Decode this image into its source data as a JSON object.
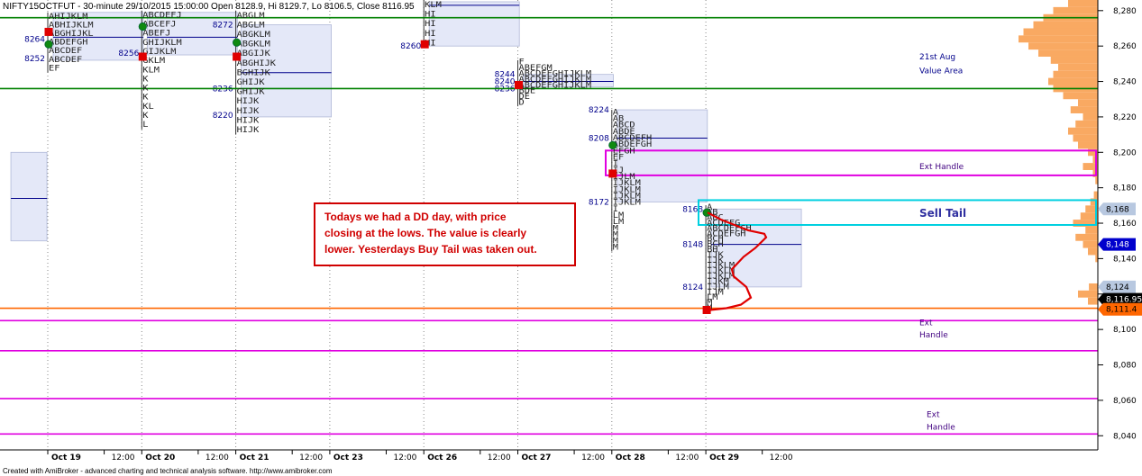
{
  "header": {
    "title": "NIFTY15OCTFUT - 30-minute 29/10/2015 15:00:00 Open 8128.9, Hi 8129.7, Lo 8106.5, Close 8116.95"
  },
  "footer": {
    "text": "Created with AmiBroker - advanced charting and technical analysis software. http://www.amibroker.com"
  },
  "annotation": {
    "lines": [
      "Todays we had a DD day, with price",
      "closing at the lows. The value is clearly",
      "lower. Yesterdays Buy Tail was taken out."
    ]
  },
  "chart_data": {
    "type": "market-profile",
    "ylim": [
      8032,
      8286
    ],
    "yticks": [
      8040,
      8060,
      8080,
      8100,
      8120,
      8140,
      8160,
      8180,
      8200,
      8220,
      8240,
      8260,
      8280
    ],
    "ytick_labels": [
      "8,040",
      "8,060",
      "8,080",
      "8,100",
      "8,120",
      "8,140",
      "8,160",
      "8,180",
      "8,200",
      "8,220",
      "8,240",
      "8,260",
      "8,280"
    ],
    "x_labels": [
      {
        "text": "Oct 19",
        "bold": true,
        "day": 0
      },
      {
        "text": "12:00",
        "bold": false,
        "day": 0.6
      },
      {
        "text": "Oct 20",
        "bold": true,
        "day": 1
      },
      {
        "text": "12:00",
        "bold": false,
        "day": 1.6
      },
      {
        "text": "Oct 21",
        "bold": true,
        "day": 2
      },
      {
        "text": "12:00",
        "bold": false,
        "day": 2.6
      },
      {
        "text": "Oct 23",
        "bold": true,
        "day": 3
      },
      {
        "text": "12:00",
        "bold": false,
        "day": 3.6
      },
      {
        "text": "Oct 26",
        "bold": true,
        "day": 4
      },
      {
        "text": "12:00",
        "bold": false,
        "day": 4.6
      },
      {
        "text": "Oct 27",
        "bold": true,
        "day": 5
      },
      {
        "text": "12:00",
        "bold": false,
        "day": 5.6
      },
      {
        "text": "Oct 28",
        "bold": true,
        "day": 6
      },
      {
        "text": "12:00",
        "bold": false,
        "day": 6.6
      },
      {
        "text": "Oct 29",
        "bold": true,
        "day": 7
      },
      {
        "text": "12:00",
        "bold": false,
        "day": 7.6
      }
    ],
    "levels": [
      {
        "price": 8276,
        "color": "#008000"
      },
      {
        "price": 8236,
        "color": "#008000"
      },
      {
        "price": 8112,
        "color": "#ff6600"
      },
      {
        "price": 8105,
        "color": "#e000e0"
      },
      {
        "price": 8088,
        "color": "#e000e0"
      },
      {
        "price": 8061,
        "color": "#e000e0"
      },
      {
        "price": 8041,
        "color": "#e000e0"
      }
    ],
    "profiles": [
      {
        "day": -0.45,
        "value_high": 8200,
        "value_low": 8150,
        "poc": 8174,
        "rows": [],
        "labels": []
      },
      {
        "day": 0,
        "value_high": 8279,
        "value_low": 8252,
        "poc": 8265,
        "high": 8279,
        "low": 8245,
        "rows": [
          "AHIJKLM",
          "ABHIJKLM",
          "ABGHIJKL",
          "ABDEFGH",
          "ABCDEF",
          "ABCDEF",
          "EF"
        ],
        "labels": [
          {
            "text": "8264",
            "price": 8264
          },
          {
            "text": "8252",
            "price": 8253
          }
        ],
        "markers": [
          {
            "type": "open",
            "price": 8261
          },
          {
            "type": "close",
            "price": 8268
          }
        ]
      },
      {
        "day": 1,
        "value_high": 8279,
        "value_low": 8255,
        "poc": 8265,
        "high": 8280,
        "low": 8213,
        "rows": [
          "ABCDEFJ",
          "ABCEFJ",
          "ABEFJ",
          "GHIJKLM",
          "GIJKLM",
          "GKLM",
          "KLM",
          "K",
          "K",
          "K",
          "KL",
          "K",
          "L"
        ],
        "labels": [
          {
            "text": "8256",
            "price": 8256
          }
        ],
        "markers": [
          {
            "type": "open",
            "price": 8271
          },
          {
            "type": "close",
            "price": 8254
          }
        ]
      },
      {
        "day": 2,
        "value_high": 8272,
        "value_low": 8220,
        "poc": 8245,
        "high": 8280,
        "low": 8210,
        "rows": [
          "ABGLM",
          "ABGLM",
          "ABGKLM",
          "ABGKLM",
          "ABGIJK",
          "ABGHIJK",
          "BGHIJK",
          "GHIJK",
          "GHIJK",
          "HIJK",
          "HIJK",
          "HIJK",
          "HIJK"
        ],
        "labels": [
          {
            "text": "8272",
            "price": 8272
          },
          {
            "text": "8236",
            "price": 8236
          },
          {
            "text": "8220",
            "price": 8221
          }
        ],
        "markers": [
          {
            "type": "open",
            "price": 8262
          },
          {
            "type": "close",
            "price": 8254
          }
        ]
      },
      {
        "day": 4,
        "value_high": 8285,
        "value_low": 8260,
        "poc": 8283,
        "high": 8286,
        "low": 8259,
        "rows": [
          "KLM",
          "HI",
          "HI",
          "HI",
          "HI"
        ],
        "labels": [
          {
            "text": "8260",
            "price": 8260
          }
        ],
        "markers": [
          {
            "type": "close",
            "price": 8261
          }
        ]
      },
      {
        "day": 5,
        "value_high": 8244,
        "value_low": 8237,
        "poc": 8240,
        "high": 8252,
        "low": 8226,
        "rows": [
          "F",
          "ABEFGM",
          "ABCDEFGHIJKLM",
          "ABCDEFGHIJKLM",
          "ABCDEFGHIJKLM",
          "BDE",
          "DE",
          "D"
        ],
        "labels": [
          {
            "text": "8244",
            "price": 8244
          },
          {
            "text": "8240",
            "price": 8240
          },
          {
            "text": "8236",
            "price": 8236
          }
        ],
        "markers": [
          {
            "type": "close",
            "price": 8238
          }
        ]
      },
      {
        "day": 6,
        "value_high": 8224,
        "value_low": 8172,
        "poc": 8208,
        "high": 8224,
        "low": 8144,
        "rows": [
          "A",
          "AB",
          "ABCD",
          "ABDE",
          "ABCDEFH",
          "ABDEFGH",
          "EFGH",
          "EF",
          "I",
          "IJ",
          "IJLM",
          "IJKLM",
          "IJKLM",
          "IJKLM",
          "IJKLM",
          "I",
          "LM",
          "LM",
          "M",
          "M",
          "M",
          "M"
        ],
        "labels": [
          {
            "text": "8224",
            "price": 8224
          },
          {
            "text": "8208",
            "price": 8208
          },
          {
            "text": "8172",
            "price": 8172
          }
        ],
        "markers": [
          {
            "type": "open",
            "price": 8204
          },
          {
            "type": "close",
            "price": 8188
          }
        ]
      },
      {
        "day": 7,
        "value_high": 8168,
        "value_low": 8124,
        "poc": 8148,
        "high": 8170,
        "low": 8110,
        "rows": [
          "A",
          "AB",
          "ABC",
          "ACDEFG",
          "ABCDEFGH",
          "ACDEFGH",
          "BCH",
          "BCH",
          "BH",
          "IJK",
          "IJK",
          "IJKLM",
          "IJKLM",
          "IJKLM",
          "IJKM",
          "IJLM",
          "IJM",
          "LM",
          "M",
          "M"
        ],
        "labels": [
          {
            "text": "8168",
            "price": 8168
          },
          {
            "text": "8148",
            "price": 8148
          },
          {
            "text": "8124",
            "price": 8124
          }
        ],
        "markers": [
          {
            "type": "open",
            "price": 8166
          },
          {
            "type": "close",
            "price": 8111
          }
        ]
      }
    ],
    "zone_labels": [
      {
        "text": "21st Aug",
        "price": 8254
      },
      {
        "text": "Value Area",
        "price": 8246
      },
      {
        "text": "Ext Handle",
        "price": 8192
      },
      {
        "text": "Sell Tail",
        "price": 8165
      },
      {
        "text": "Ext",
        "price": 8104
      },
      {
        "text": "Handle",
        "price": 8097
      },
      {
        "text": "Ext",
        "price": 8052
      },
      {
        "text": "Handle",
        "price": 8045
      }
    ],
    "boxes": [
      {
        "name": "ext-handle-box",
        "y_high": 8201,
        "y_low": 8187,
        "color": "#e000e0"
      },
      {
        "name": "sell-tail-box",
        "y_high": 8173,
        "y_low": 8159,
        "color": "#00d0e0"
      }
    ],
    "price_tags": [
      {
        "text": "8,168",
        "price": 8168,
        "bg": "#b8c8e0",
        "fg": "#000000"
      },
      {
        "text": "8,148",
        "price": 8148,
        "bg": "#0000cc",
        "fg": "#ffffff"
      },
      {
        "text": "8,124",
        "price": 8124,
        "bg": "#b8c8e0",
        "fg": "#000000"
      },
      {
        "text": "8,116.95",
        "price": 8117,
        "bg": "#000000",
        "fg": "#ffffff"
      },
      {
        "text": "8,111.4",
        "price": 8111.4,
        "bg": "#ff6600",
        "fg": "#000000"
      }
    ],
    "volume_profile": [
      [
        8284,
        60
      ],
      [
        8280,
        90
      ],
      [
        8276,
        110
      ],
      [
        8272,
        130
      ],
      [
        8268,
        150
      ],
      [
        8264,
        160
      ],
      [
        8260,
        140
      ],
      [
        8256,
        120
      ],
      [
        8252,
        95
      ],
      [
        8248,
        80
      ],
      [
        8244,
        90
      ],
      [
        8240,
        100
      ],
      [
        8236,
        90
      ],
      [
        8232,
        70
      ],
      [
        8228,
        40
      ],
      [
        8224,
        55
      ],
      [
        8220,
        30
      ],
      [
        8216,
        45
      ],
      [
        8212,
        60
      ],
      [
        8208,
        50
      ],
      [
        8204,
        40
      ],
      [
        8200,
        20
      ],
      [
        8196,
        10
      ],
      [
        8192,
        30
      ],
      [
        8188,
        10
      ],
      [
        8184,
        5
      ],
      [
        8176,
        8
      ],
      [
        8172,
        15
      ],
      [
        8168,
        25
      ],
      [
        8164,
        35
      ],
      [
        8160,
        50
      ],
      [
        8156,
        25
      ],
      [
        8152,
        45
      ],
      [
        8148,
        30
      ],
      [
        8144,
        20
      ],
      [
        8140,
        5
      ],
      [
        8124,
        18
      ],
      [
        8120,
        40
      ],
      [
        8116,
        20
      ]
    ]
  }
}
